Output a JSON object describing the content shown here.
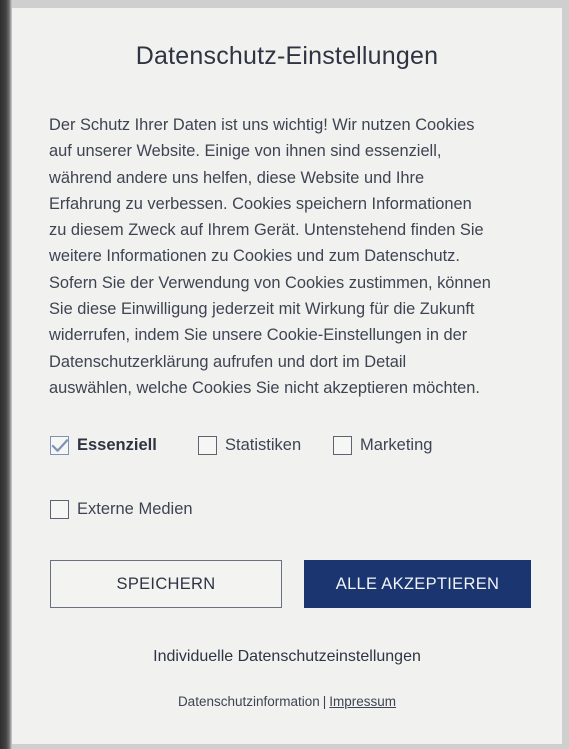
{
  "dialog": {
    "title": "Datenschutz-Einstellungen",
    "description": "Der Schutz Ihrer Daten ist uns wichtig! Wir nutzen Cookies\nauf unserer Website. Einige von ihnen sind essenziell,\nwährend andere uns helfen, diese Website und Ihre\nErfahrung zu verbessen. Cookies speichern Informationen\nzu diesem Zweck auf Ihrem Gerät. Untenstehend finden Sie\nweitere Informationen zu Cookies und zum Datenschutz.\nSofern Sie der Verwendung von Cookies zustimmen, können\nSie diese Einwilligung jederzeit mit Wirkung für die Zukunft\nwiderrufen, indem Sie unsere Cookie-Einstellungen in der\nDatenschutzerklärung aufrufen und dort im Detail\nauswählen, welche Cookies Sie nicht akzeptieren möchten."
  },
  "options": [
    {
      "label": "Essenziell",
      "checked": true
    },
    {
      "label": "Statistiken",
      "checked": false
    },
    {
      "label": "Marketing",
      "checked": false
    },
    {
      "label": "Externe Medien",
      "checked": false
    }
  ],
  "buttons": {
    "save": "SPEICHERN",
    "accept_all": "ALLE AKZEPTIEREN"
  },
  "links": {
    "individual": "Individuelle Datenschutzeinstellungen",
    "privacy_info": "Datenschutzinformation",
    "separator": "|",
    "imprint": "Impressum"
  },
  "colors": {
    "accent": "#1a3570",
    "check": "#7f93b8",
    "background": "#f1f1ef"
  },
  "icons": {
    "checked": "checkmark-icon"
  }
}
